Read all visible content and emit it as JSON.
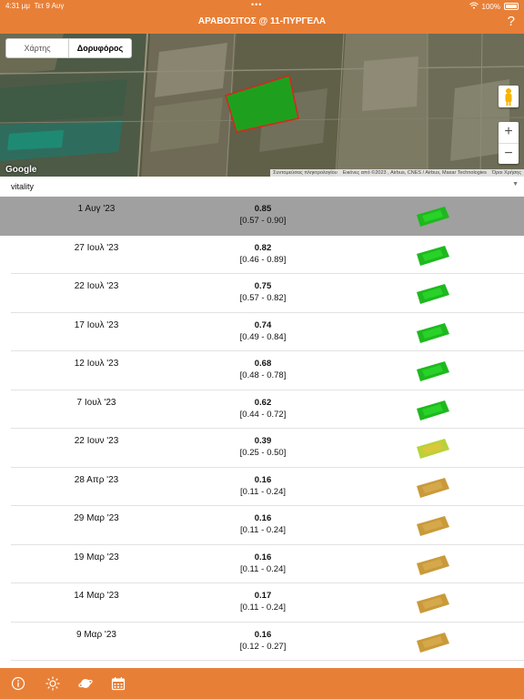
{
  "status": {
    "time": "4:31 μμ",
    "date": "Τετ 9 Αυγ",
    "battery": "100%"
  },
  "header": {
    "title": "ΑΡΑΒΟΣΙΤΟΣ @ 11-ΠΥΡΓΕΛΑ",
    "help": "?"
  },
  "map": {
    "segments": {
      "map_label": "Χάρτης",
      "satellite_label": "Δορυφόρος",
      "selected": "satellite"
    },
    "zoom_in": "+",
    "zoom_out": "−",
    "provider": "Google",
    "attribution": {
      "shortcuts": "Συντομεύσεις πληκτρολογίου",
      "imagery": "Εικόνες από ©2023 , Airbus, CNES / Airbus, Maxar Technologies",
      "terms": "Όροι Χρήσης"
    }
  },
  "index_selector": {
    "value": "vitality"
  },
  "records": [
    {
      "date": "1 Αυγ '23",
      "value": "0.85",
      "range": "[0.57 - 0.90]",
      "selected": true
    },
    {
      "date": "27 Ιουλ '23",
      "value": "0.82",
      "range": "[0.46 - 0.89]",
      "selected": false
    },
    {
      "date": "22 Ιουλ '23",
      "value": "0.75",
      "range": "[0.57 - 0.82]",
      "selected": false
    },
    {
      "date": "17 Ιουλ '23",
      "value": "0.74",
      "range": "[0.49 - 0.84]",
      "selected": false
    },
    {
      "date": "12 Ιουλ '23",
      "value": "0.68",
      "range": "[0.48 - 0.78]",
      "selected": false
    },
    {
      "date": "7 Ιουλ '23",
      "value": "0.62",
      "range": "[0.44 - 0.72]",
      "selected": false
    },
    {
      "date": "22 Ιουν '23",
      "value": "0.39",
      "range": "[0.25 - 0.50]",
      "selected": false
    },
    {
      "date": "28 Απρ '23",
      "value": "0.16",
      "range": "[0.11 - 0.24]",
      "selected": false
    },
    {
      "date": "29 Μαρ '23",
      "value": "0.16",
      "range": "[0.11 - 0.24]",
      "selected": false
    },
    {
      "date": "19 Μαρ '23",
      "value": "0.16",
      "range": "[0.11 - 0.24]",
      "selected": false
    },
    {
      "date": "14 Μαρ '23",
      "value": "0.17",
      "range": "[0.11 - 0.24]",
      "selected": false
    },
    {
      "date": "9 Μαρ '23",
      "value": "0.16",
      "range": "[0.12 - 0.27]",
      "selected": false
    }
  ],
  "tabbar": {
    "items": [
      {
        "icon": "info-icon"
      },
      {
        "icon": "sun-icon"
      },
      {
        "icon": "planet-icon"
      },
      {
        "icon": "calendar-icon"
      }
    ]
  },
  "colors": {
    "brand": "#e87f36",
    "selected_row": "#a0a0a0",
    "field_outline": "#d7261e",
    "healthy": "#1fc21f",
    "dry": "#c99a3a"
  }
}
